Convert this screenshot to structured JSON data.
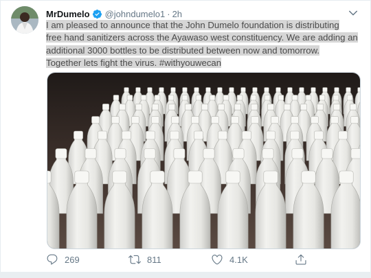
{
  "tweet": {
    "author_name": "MrDumelo",
    "handle": "@johndumelo1",
    "separator": "·",
    "time": "2h",
    "text_lines": [
      "I am pleased to announce that the John Dumelo foundation is distributing",
      "free hand sanitizers across the Ayawaso west constituency. We are adding an",
      "additional 3000 bottles to be distributed between now and tomorrow.",
      "Together lets fight the virus. #withyouwecan"
    ],
    "media": {
      "description": "rows of white plastic sanitizer bottles"
    }
  },
  "actions": {
    "replies": "269",
    "retweets": "811",
    "likes": "4.1K"
  },
  "icons": {
    "verified": "verified-badge-icon",
    "more": "chevron-down-icon",
    "reply": "reply-icon",
    "retweet": "retweet-icon",
    "like": "heart-icon",
    "share": "share-icon"
  },
  "colors": {
    "accent": "#1da1f2",
    "muted": "#657786",
    "highlight": "#d6d6d6"
  }
}
